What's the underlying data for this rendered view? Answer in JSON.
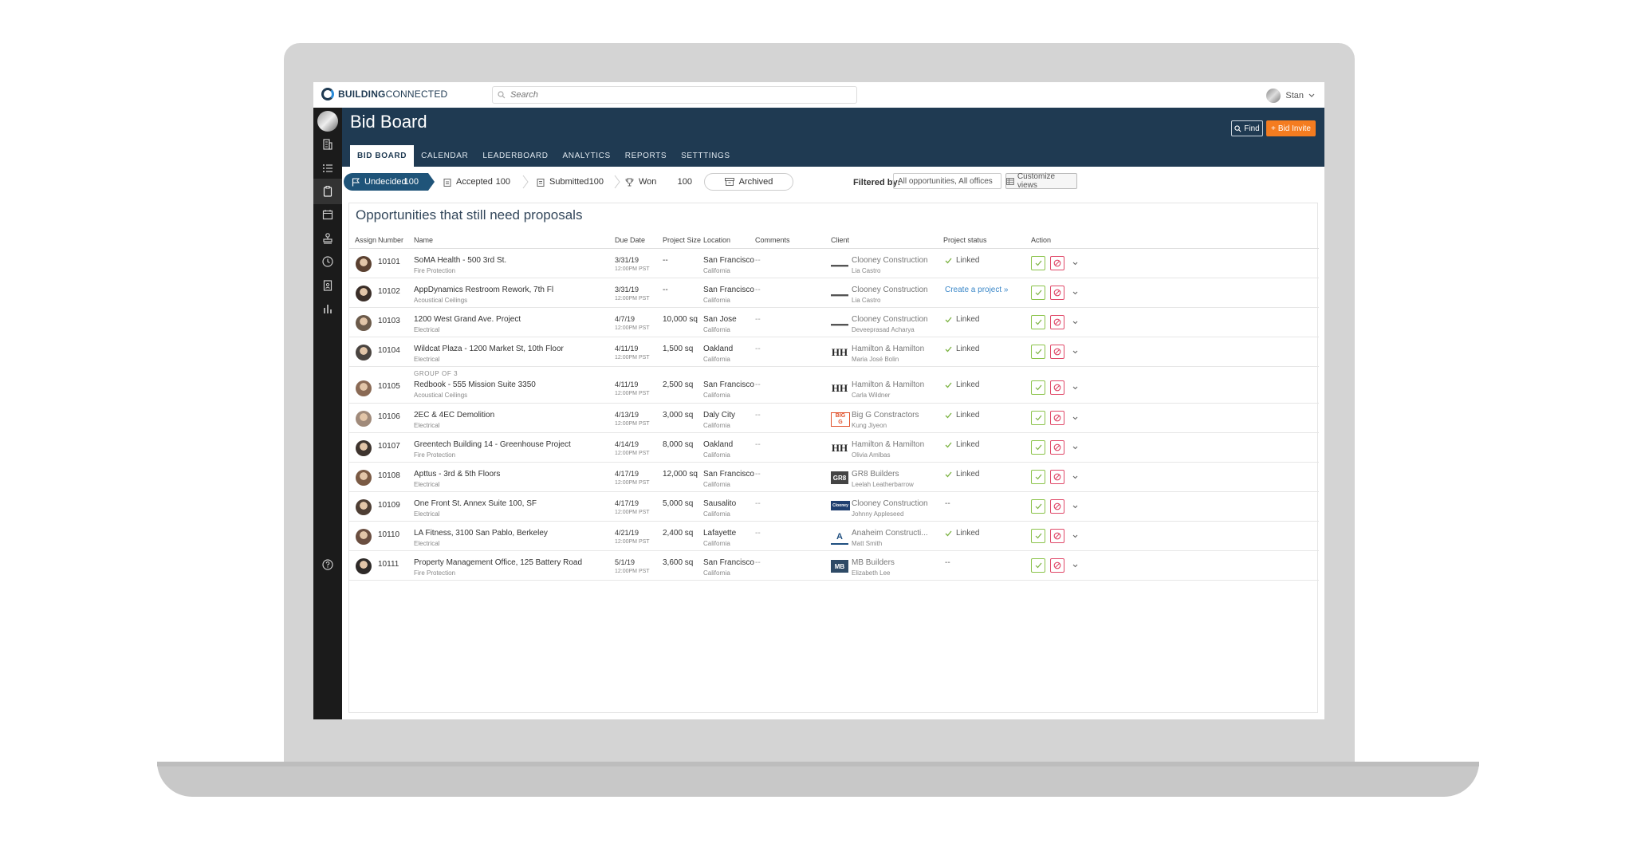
{
  "app": {
    "brand_bold": "BUILDING",
    "brand_light": "CONNECTED"
  },
  "search": {
    "placeholder": "Search"
  },
  "user": {
    "name": "Stan"
  },
  "header": {
    "title": "Bid Board",
    "tabs": [
      "BID BOARD",
      "CALENDAR",
      "LEADERBOARD",
      "ANALYTICS",
      "REPORTS",
      "SETTTINGS"
    ],
    "find_label": "Find",
    "bid_invite_label": "Bid Invite"
  },
  "stages": [
    {
      "label": "Undecided",
      "count": "100"
    },
    {
      "label": "Accepted",
      "count": "100"
    },
    {
      "label": "Submitted",
      "count": "100"
    },
    {
      "label": "Won",
      "count": "100"
    }
  ],
  "archived_label": "Archived",
  "filter": {
    "label": "Filtered by:",
    "value": "All opportunities, All offices",
    "customize_label": "Customize views"
  },
  "table": {
    "title": "Opportunities that still need proposals",
    "columns": [
      "Assign",
      "Number",
      "Name",
      "Due Date",
      "Project Size",
      "Location",
      "Comments",
      "Client",
      "Project status",
      "Action"
    ],
    "rows": [
      {
        "number": "10101",
        "name": "SoMA Health - 500 3rd St.",
        "trade": "Fire Protection",
        "date": "3/31/19",
        "time": "12:00PM PST",
        "size": "--",
        "city": "San Francisco",
        "state": "California",
        "comments": "--",
        "client": "Clooney Construction",
        "contact": "Lia Castro",
        "status": "Linked"
      },
      {
        "number": "10102",
        "name": "AppDynamics Restroom Rework, 7th Fl",
        "trade": "Acoustical Ceilings",
        "date": "3/31/19",
        "time": "12:00PM PST",
        "size": "--",
        "city": "San Francisco",
        "state": "California",
        "comments": "--",
        "client": "Clooney Construction",
        "contact": "Lia Castro",
        "status": "Create a project »"
      },
      {
        "number": "10103",
        "name": "1200 West Grand Ave. Project",
        "trade": "Electrical",
        "date": "4/7/19",
        "time": "12:00PM PST",
        "size": "10,000 sq",
        "city": "San Jose",
        "state": "California",
        "comments": "--",
        "client": "Clooney Construction",
        "contact": "Deveeprasad Acharya",
        "status": "Linked"
      },
      {
        "number": "10104",
        "name": "Wildcat Plaza - 1200 Market St, 10th Floor",
        "trade": "Electrical",
        "date": "4/11/19",
        "time": "12:00PM PST",
        "size": "1,500 sq",
        "city": "Oakland",
        "state": "California",
        "comments": "--",
        "client": "Hamilton & Hamilton",
        "contact": "Maria José Bolin",
        "status": "Linked"
      },
      {
        "number": "10105",
        "group": "GROUP OF 3",
        "name": "Redbook - 555 Mission Suite 3350",
        "trade": "Acoustical Ceilings",
        "date": "4/11/19",
        "time": "12:00PM PST",
        "size": "2,500 sq",
        "city": "San Francisco",
        "state": "California",
        "comments": "--",
        "client": "Hamilton & Hamilton",
        "contact": "Carla Wildner",
        "status": "Linked"
      },
      {
        "number": "10106",
        "name": "2EC & 4EC Demolition",
        "trade": "Electrical",
        "date": "4/13/19",
        "time": "12:00PM PST",
        "size": "3,000 sq",
        "city": "Daly City",
        "state": "California",
        "comments": "--",
        "client": "Big G Constractors",
        "contact": "Kung Jiyeon",
        "status": "Linked"
      },
      {
        "number": "10107",
        "name": "Greentech Building 14 - Greenhouse Project",
        "trade": "Fire Protection",
        "date": "4/14/19",
        "time": "12:00PM PST",
        "size": "8,000 sq",
        "city": "Oakland",
        "state": "California",
        "comments": "--",
        "client": "Hamilton & Hamilton",
        "contact": "Olivia Amlbas",
        "status": "Linked"
      },
      {
        "number": "10108",
        "name": "Apttus - 3rd & 5th Floors",
        "trade": "Electrical",
        "date": "4/17/19",
        "time": "12:00PM PST",
        "size": "12,000 sq",
        "city": "San Francisco",
        "state": "California",
        "comments": "--",
        "client": "GR8 Builders",
        "contact": "Leelah Leatherbarrow",
        "status": "Linked"
      },
      {
        "number": "10109",
        "name": "One Front St. Annex Suite 100, SF",
        "trade": "Electrical",
        "date": "4/17/19",
        "time": "12:00PM PST",
        "size": "5,000 sq",
        "city": "Sausalito",
        "state": "California",
        "comments": "--",
        "client": "Clooney Construction",
        "contact": "Johnny Appleseed",
        "status": "--"
      },
      {
        "number": "10110",
        "name": "LA Fitness, 3100 San Pablo, Berkeley",
        "trade": "Electrical",
        "date": "4/21/19",
        "time": "12:00PM PST",
        "size": "2,400 sq",
        "city": "Lafayette",
        "state": "California",
        "comments": "--",
        "client": "Anaheim Constructi...",
        "contact": "Matt Smith",
        "status": "Linked"
      },
      {
        "number": "10111",
        "name": "Property Management Office, 125 Battery Road",
        "trade": "Fire Protection",
        "date": "5/1/19",
        "time": "12:00PM PST",
        "size": "3,600 sq",
        "city": "San Francisco",
        "state": "California",
        "comments": "--",
        "client": "MB Builders",
        "contact": "Elizabeth Lee",
        "status": "--"
      }
    ]
  },
  "logos": [
    "line",
    "line",
    "line",
    "HH",
    "HH",
    "BIG G",
    "HH",
    "GR8",
    "Clooney",
    "A",
    "MB"
  ],
  "colors": {
    "header": "#1f3a52",
    "accent": "#f47c20",
    "active_stage": "#1f5479",
    "accept": "#8bc34a",
    "decline": "#e04868",
    "link": "#3a87c8"
  }
}
